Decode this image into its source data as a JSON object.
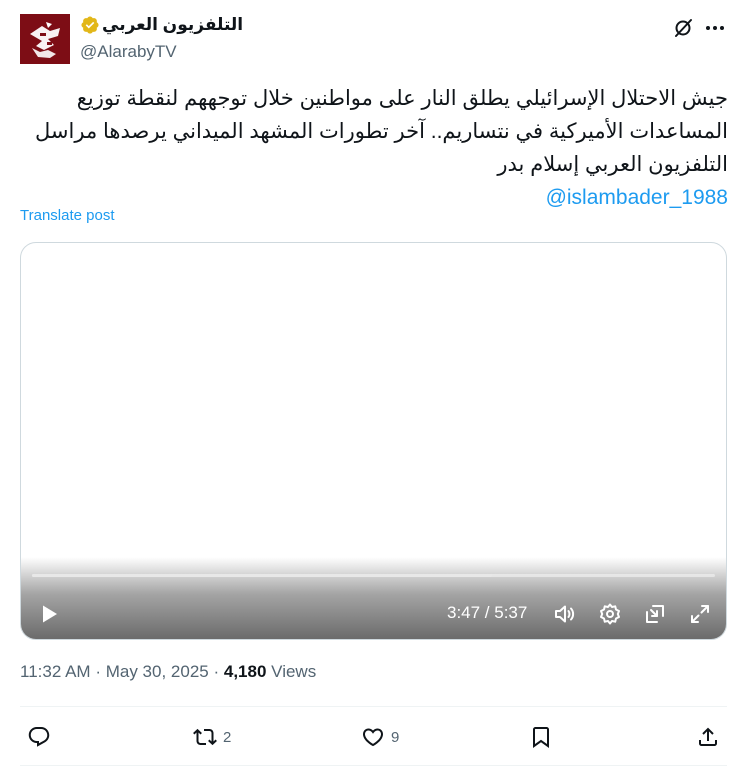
{
  "account": {
    "display_name": "التلفزيون العربي",
    "handle": "@AlarabyTV",
    "verified_color": "#e2b719"
  },
  "post": {
    "text": "جيش الاحتلال الإسرائيلي يطلق النار على مواطنين خلال توجههم لنقطة توزيع المساعدات الأميركية في نتساريم.. آخر تطورات المشهد الميداني يرصدها مراسل التلفزيون العربي إسلام بدر",
    "mention": "@islambader_1988",
    "translate_label": "Translate post"
  },
  "video": {
    "time_display": "3:47 / 5:37",
    "progress_fraction": 0.674
  },
  "meta": {
    "time": "11:32 AM",
    "separator": "·",
    "date": "May 30, 2025",
    "views_count": "4,180",
    "views_label": "Views"
  },
  "actions": {
    "replies": "",
    "reposts": "2",
    "likes": "9"
  },
  "colors": {
    "accent": "#1d9bf0",
    "secondary_text": "#536471",
    "avatar_bg": "#7d0d15"
  }
}
